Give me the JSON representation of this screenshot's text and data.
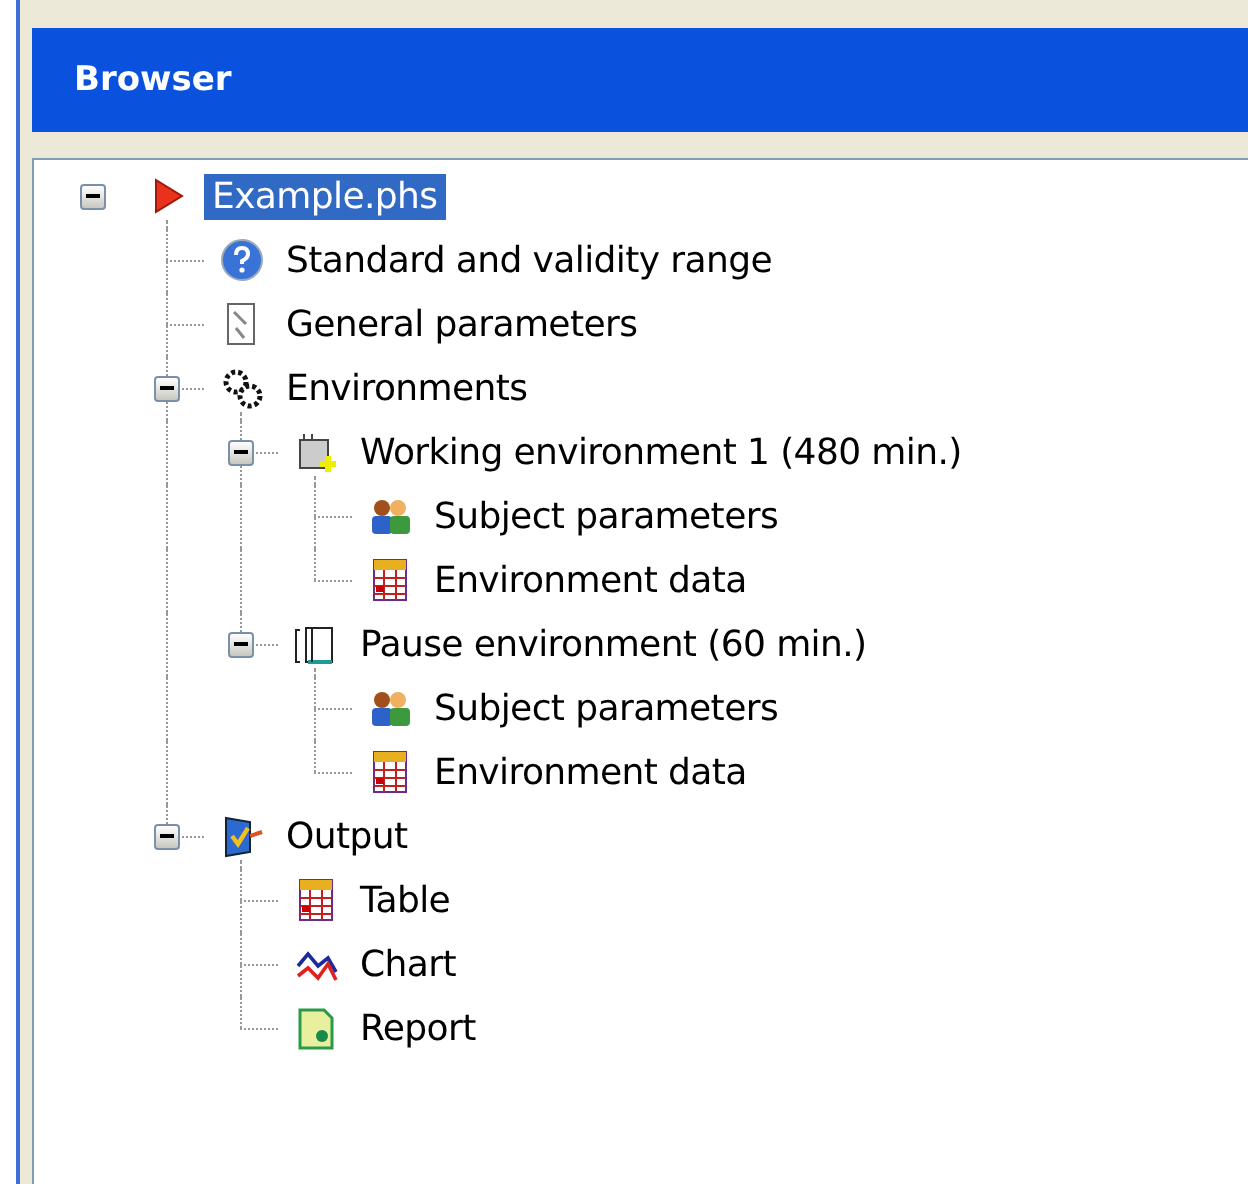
{
  "panel": {
    "title": "Browser"
  },
  "tree": [
    {
      "label": "Example.phs",
      "kind": "run",
      "selected": true,
      "expanded": true,
      "children": [
        {
          "label": "Standard and validity range",
          "kind": "help",
          "selected": false
        },
        {
          "label": "General parameters",
          "kind": "document",
          "selected": false
        },
        {
          "label": "Environments",
          "kind": "gears",
          "selected": false,
          "expanded": true,
          "children": [
            {
              "label": "Working environment 1 (480 min.)",
              "kind": "environment",
              "selected": false,
              "expanded": true,
              "children": [
                {
                  "label": "Subject parameters",
                  "kind": "people",
                  "selected": false
                },
                {
                  "label": "Environment data",
                  "kind": "table",
                  "selected": false
                }
              ]
            },
            {
              "label": "Pause environment (60 min.)",
              "kind": "pause",
              "selected": false,
              "expanded": true,
              "children": [
                {
                  "label": "Subject parameters",
                  "kind": "people",
                  "selected": false
                },
                {
                  "label": "Environment data",
                  "kind": "table",
                  "selected": false
                }
              ]
            }
          ]
        },
        {
          "label": "Output",
          "kind": "output",
          "selected": false,
          "expanded": true,
          "children": [
            {
              "label": "Table",
              "kind": "table",
              "selected": false
            },
            {
              "label": "Chart",
              "kind": "chart",
              "selected": false
            },
            {
              "label": "Report",
              "kind": "report",
              "selected": false
            }
          ]
        }
      ]
    }
  ]
}
